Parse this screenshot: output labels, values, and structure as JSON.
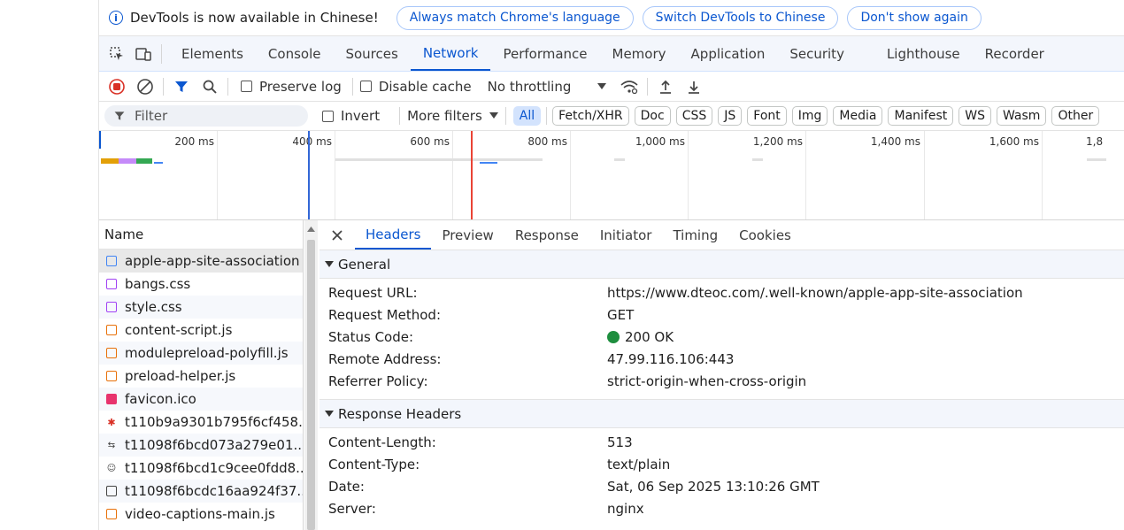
{
  "infobar": {
    "message": "DevTools is now available in Chinese!",
    "buttons": [
      "Always match Chrome's language",
      "Switch DevTools to Chinese",
      "Don't show again"
    ]
  },
  "tabs": [
    "Elements",
    "Console",
    "Sources",
    "Network",
    "Performance",
    "Memory",
    "Application",
    "Security",
    "Lighthouse",
    "Recorder"
  ],
  "active_tab": "Network",
  "toolbar": {
    "preserve_log": "Preserve log",
    "disable_cache": "Disable cache",
    "throttling": "No throttling"
  },
  "filterbar": {
    "placeholder": "Filter",
    "invert": "Invert",
    "more_filters": "More filters",
    "types": [
      "All",
      "Fetch/XHR",
      "Doc",
      "CSS",
      "JS",
      "Font",
      "Img",
      "Media",
      "Manifest",
      "WS",
      "Wasm",
      "Other"
    ]
  },
  "overview": {
    "ticks": [
      "200 ms",
      "400 ms",
      "600 ms",
      "800 ms",
      "1,000 ms",
      "1,200 ms",
      "1,400 ms",
      "1,600 ms",
      "1,8"
    ]
  },
  "requests": {
    "header": "Name",
    "items": [
      {
        "name": "apple-app-site-association",
        "icon": "doc-icon"
      },
      {
        "name": "bangs.css",
        "icon": "css-icon"
      },
      {
        "name": "style.css",
        "icon": "css-icon"
      },
      {
        "name": "content-script.js",
        "icon": "js-icon"
      },
      {
        "name": "modulepreload-polyfill.js",
        "icon": "js-icon"
      },
      {
        "name": "preload-helper.js",
        "icon": "js-icon"
      },
      {
        "name": "favicon.ico",
        "icon": "favicon-icon"
      },
      {
        "name": "t110b9a9301b795f6cf458...",
        "icon": "image-icon"
      },
      {
        "name": "t11098f6bcd073a279e01...",
        "icon": "image-icon"
      },
      {
        "name": "t11098f6bcd1c9cee0fdd8...",
        "icon": "image-icon"
      },
      {
        "name": "t11098f6bcdc16aa924f37...",
        "icon": "image-icon"
      },
      {
        "name": "video-captions-main.js",
        "icon": "js-icon"
      }
    ]
  },
  "details": {
    "tabs": [
      "Headers",
      "Preview",
      "Response",
      "Initiator",
      "Timing",
      "Cookies"
    ],
    "general_title": "General",
    "general": [
      {
        "k": "Request URL:",
        "v": "https://www.dteoc.com/.well-known/apple-app-site-association"
      },
      {
        "k": "Request Method:",
        "v": "GET"
      },
      {
        "k": "Status Code:",
        "v": "200 OK"
      },
      {
        "k": "Remote Address:",
        "v": "47.99.116.106:443"
      },
      {
        "k": "Referrer Policy:",
        "v": "strict-origin-when-cross-origin"
      }
    ],
    "response_title": "Response Headers",
    "response": [
      {
        "k": "Content-Length:",
        "v": "513"
      },
      {
        "k": "Content-Type:",
        "v": "text/plain"
      },
      {
        "k": "Date:",
        "v": "Sat, 06 Sep 2025 13:10:26 GMT"
      },
      {
        "k": "Server:",
        "v": "nginx"
      }
    ]
  },
  "colors": {
    "accent": "#0b57d0",
    "status_ok": "#1e8e3e",
    "record": "#d93025"
  }
}
